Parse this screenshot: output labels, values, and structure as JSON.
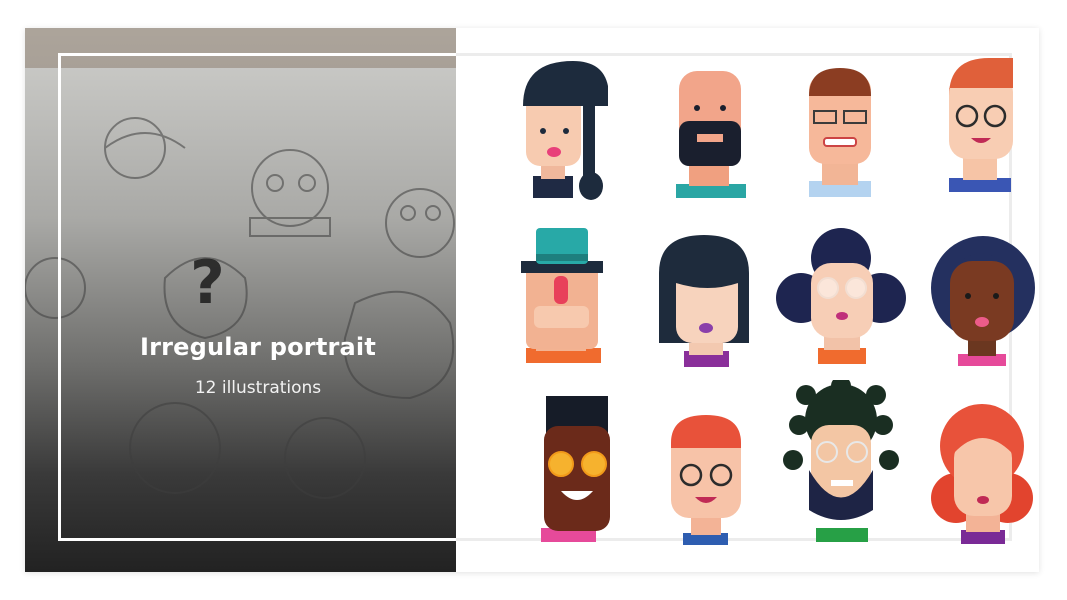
{
  "cover": {
    "title": "Irregular portrait",
    "subtitle": "12 illustrations"
  },
  "gallery": {
    "avatars": [
      {
        "icon": "woman-braid-avatar-icon"
      },
      {
        "icon": "bald-bearded-man-avatar-icon"
      },
      {
        "icon": "man-glasses-avatar-icon"
      },
      {
        "icon": "redhead-glasses-avatar-icon"
      },
      {
        "icon": "man-hat-avatar-icon"
      },
      {
        "icon": "woman-black-bob-avatar-icon"
      },
      {
        "icon": "woman-afro-puffs-avatar-icon"
      },
      {
        "icon": "woman-curly-hair-avatar-icon"
      },
      {
        "icon": "man-sunglasses-avatar-icon"
      },
      {
        "icon": "redhead-man-glasses-avatar-icon"
      },
      {
        "icon": "man-dreadlocks-beard-avatar-icon"
      },
      {
        "icon": "woman-red-hair-avatar-icon"
      }
    ]
  },
  "colors": {
    "navy": "#1f2a44",
    "skin_light": "#f7cbb0",
    "skin_dark": "#7a3a22",
    "red_hair": "#e8523a",
    "teal": "#28a9a7",
    "purple": "#8a2f9a"
  }
}
